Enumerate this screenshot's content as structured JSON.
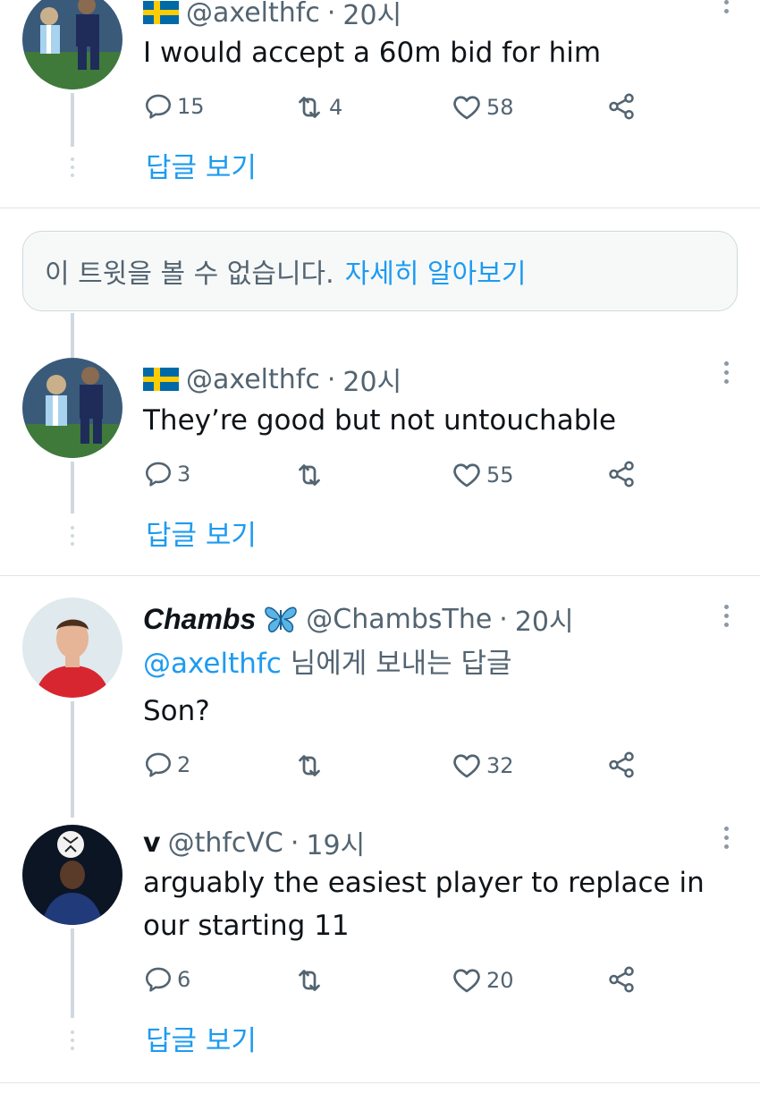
{
  "tweets": [
    {
      "handle": "@axelthfc",
      "separator": "·",
      "time": "20시",
      "text": "I would accept a 60m bid for him",
      "replies": "15",
      "retweets": "4",
      "likes": "58",
      "view_replies": "답글 보기"
    },
    {
      "handle": "@axelthfc",
      "separator": "·",
      "time": "20시",
      "text": "They’re good but not untouchable",
      "replies": "3",
      "retweets": "",
      "likes": "55",
      "view_replies": "답글 보기"
    },
    {
      "name": "Chambs",
      "handle": "@ChambsThe",
      "separator": "·",
      "time": "20시",
      "reply_to_handle": "@axelthfc",
      "reply_to_suffix": "님에게 보내는 답글",
      "text": "Son?",
      "replies": "2",
      "retweets": "",
      "likes": "32"
    },
    {
      "name": "v",
      "handle": "@thfcVC",
      "separator": "·",
      "time": "19시",
      "text_line1": "arguably the easiest player to replace in",
      "text_line2": "our starting 11",
      "replies": "6",
      "retweets": "",
      "likes": "20",
      "view_replies": "답글 보기"
    }
  ],
  "notice": {
    "text": "이 트윗을 볼 수 없습니다.",
    "link": "자세히 알아보기"
  },
  "icons": {
    "reply": "reply-icon",
    "retweet": "retweet-icon",
    "like": "heart-icon",
    "share": "share-icon",
    "more": "more-vertical-icon",
    "flag": "sweden-flag-icon",
    "butterfly": "butterfly-emoji-icon"
  },
  "colors": {
    "accent": "#1d9bf0",
    "muted": "#536471",
    "text": "#0f1419",
    "border": "#cfd9de"
  }
}
